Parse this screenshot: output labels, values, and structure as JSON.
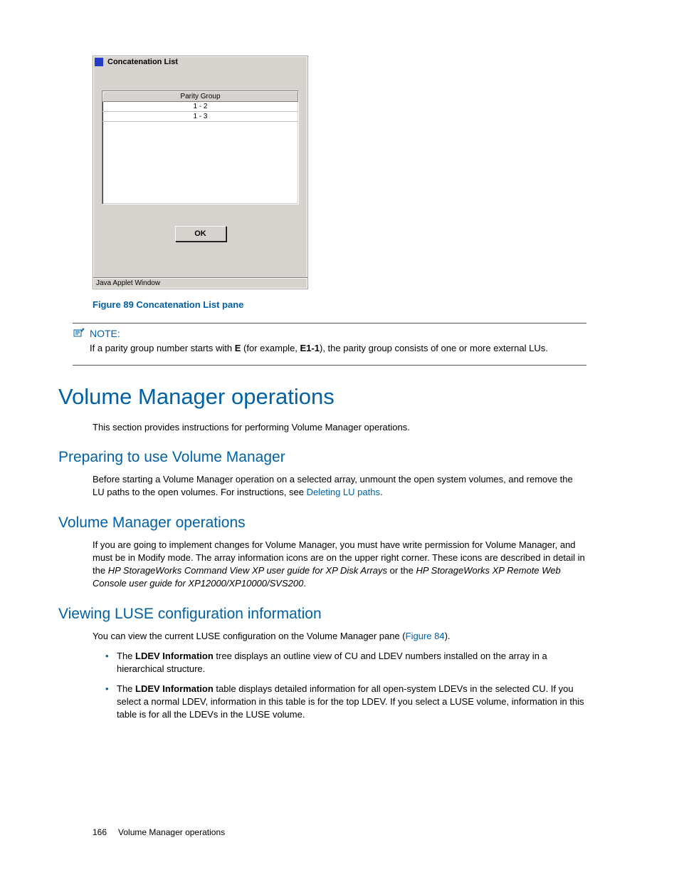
{
  "applet": {
    "title": "Concatenation List",
    "column_header": "Parity Group",
    "rows": [
      "1 - 2",
      "1 - 3"
    ],
    "ok_label": "OK",
    "status": "Java Applet Window"
  },
  "caption": "Figure 89 Concatenation List pane",
  "note": {
    "label": "NOTE:",
    "text_a": "If a parity group number starts with ",
    "bold_a": "E",
    "text_b": " (for example, ",
    "bold_b": "E1-1",
    "text_c": "), the parity group consists of one or more external LUs."
  },
  "section": {
    "title": "Volume Manager operations",
    "intro": "This section provides instructions for performing Volume Manager operations."
  },
  "preparing": {
    "title": "Preparing to use Volume Manager",
    "text_a": "Before starting a Volume Manager operation on a selected array, unmount the open system volumes, and remove the LU paths to the open volumes. For instructions, see ",
    "link": "Deleting LU paths",
    "text_b": "."
  },
  "vmops": {
    "title": "Volume Manager operations",
    "text_a": "If you are going to implement changes for Volume Manager, you must have write permission for Volume Manager, and must be in Modify mode. The array information icons are on the upper right corner. These icons are described in detail in the ",
    "ital_a": "HP StorageWorks Command View XP user guide for XP Disk Arrays",
    "text_b": " or the ",
    "ital_b": "HP StorageWorks XP Remote Web Console user guide for XP12000/XP10000/SVS200",
    "text_c": "."
  },
  "viewing": {
    "title": "Viewing LUSE configuration information",
    "intro_a": "You can view the current LUSE configuration on the Volume Manager pane (",
    "intro_link": "Figure 84",
    "intro_b": ").",
    "bullets": [
      {
        "a": "The ",
        "bold": "LDEV Information",
        "b": " tree displays an outline view of CU and LDEV numbers installed on the array in a hierarchical structure."
      },
      {
        "a": "The ",
        "bold": "LDEV Information",
        "b": " table displays detailed information for all open-system LDEVs in the selected CU. If you select a normal LDEV, information in this table is for the top LDEV. If you select a LUSE volume, information in this table is for all the LDEVs in the LUSE volume."
      }
    ]
  },
  "footer": {
    "page": "166",
    "title": "Volume Manager operations"
  }
}
